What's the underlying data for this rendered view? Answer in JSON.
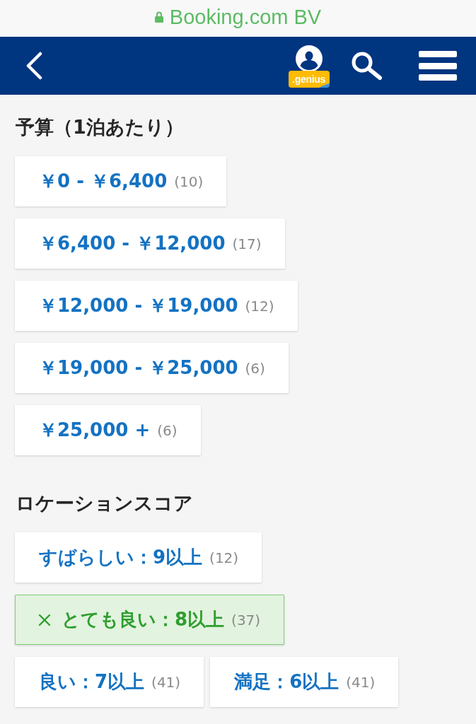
{
  "address_bar": {
    "site": "Booking.com BV"
  },
  "nav": {
    "genius_badge": ".genius"
  },
  "sections": [
    {
      "heading": "予算（1泊あたり）",
      "filters": [
        {
          "label": "￥0 - ￥6,400",
          "count": "(10)",
          "selected": false
        },
        {
          "label": "￥6,400 - ￥12,000",
          "count": "(17)",
          "selected": false
        },
        {
          "label": "￥12,000 - ￥19,000",
          "count": "(12)",
          "selected": false
        },
        {
          "label": "￥19,000 - ￥25,000",
          "count": "(6)",
          "selected": false
        },
        {
          "label": "￥25,000 +",
          "count": "(6)",
          "selected": false
        }
      ]
    },
    {
      "heading": "ロケーションスコア",
      "filters": [
        {
          "label": "すばらしい：9以上",
          "count": "(12)",
          "selected": false
        },
        {
          "label": "とても良い：8以上",
          "count": "(37)",
          "selected": true
        },
        {
          "label": "良い：7以上",
          "count": "(41)",
          "selected": false
        },
        {
          "label": "満足：6以上",
          "count": "(41)",
          "selected": false
        }
      ]
    }
  ]
}
